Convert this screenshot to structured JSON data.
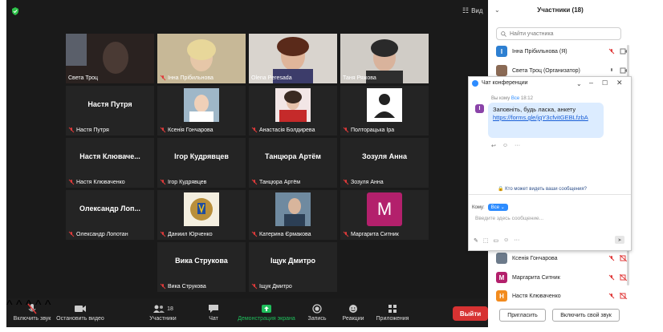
{
  "toolbar_top": {
    "view_label": "Вид"
  },
  "tiles": [
    {
      "name": "Света Троц",
      "big": ""
    },
    {
      "name": "Інна Прібильнова",
      "big": ""
    },
    {
      "name": "Olena Peresada",
      "big": ""
    },
    {
      "name": "Таня Ряжова",
      "big": ""
    },
    {
      "name": "Настя Путря",
      "big": "Настя Путря"
    },
    {
      "name": "Ксенія Гончарова",
      "big": ""
    },
    {
      "name": "Анастасія Болдирева",
      "big": ""
    },
    {
      "name": "Полторацька Іра",
      "big": ""
    },
    {
      "name": "Настя Клюваченко",
      "big": "Настя Клюваче..."
    },
    {
      "name": "Ігор Кудрявцев",
      "big": "Ігор Кудрявцев"
    },
    {
      "name": "Танцюра Артём",
      "big": "Танцюра Артём"
    },
    {
      "name": "Зозуля Анна",
      "big": "Зозуля Анна"
    },
    {
      "name": "Олександр Лопотан",
      "big": "Олександр Лоп..."
    },
    {
      "name": "Даниил Юрченко",
      "big": ""
    },
    {
      "name": "Катерина Єрмакова",
      "big": ""
    },
    {
      "name": "Маргарита Ситник",
      "big": "M"
    },
    {
      "name": "Вика Струкова",
      "big": "Вика Струкова"
    },
    {
      "name": "Іщук Дмитро",
      "big": "Іщук Дмитро"
    }
  ],
  "bottom_toolbar": {
    "mute": "Включить звук",
    "video": "Остановить видео",
    "participants": "Участники",
    "participants_count": "18",
    "chat": "Чат",
    "share": "Демонстрация экрана",
    "record": "Запись",
    "reactions": "Реакции",
    "apps": "Приложения",
    "leave": "Выйти"
  },
  "participants_panel": {
    "title": "Участники (18)",
    "search_placeholder": "Найти участника",
    "rows_top": [
      {
        "name": "Інна Прібильнова (Я)",
        "initial": "I",
        "color": "#2d7fd1"
      },
      {
        "name": "Света Троц (Организатор)",
        "initial": "",
        "color": "#8a6a55"
      }
    ],
    "rows_bottom": [
      {
        "name": "Ксенія Гончарова",
        "initial": "",
        "color": "#6c7a8a"
      },
      {
        "name": "Маргарита Ситник",
        "initial": "M",
        "color": "#b3206c"
      },
      {
        "name": "Настя Клюваченко",
        "initial": "H",
        "color": "#f28b1e"
      }
    ],
    "invite": "Пригласить",
    "unmute_self": "Включить свой звук"
  },
  "chat": {
    "title": "Чат конференции",
    "meta_from": "Вы кому",
    "meta_to": "Все",
    "meta_time": "18:12",
    "avatar_initial": "I",
    "message_text": "Заповніть, будь ласка, анкету",
    "message_link": "https://forms.gle/jqY3cfvitGEBLfzbA",
    "who_can_see": "Кто может видеть ваши сообщения?",
    "to_label": "Кому:",
    "to_value": "Все",
    "input_placeholder": "Введите здесь сообщение..."
  },
  "colors": {
    "active_speaker": "#b8e04a",
    "leave": "#d73232",
    "share": "#1fbf5c",
    "accent": "#2d8cff"
  }
}
